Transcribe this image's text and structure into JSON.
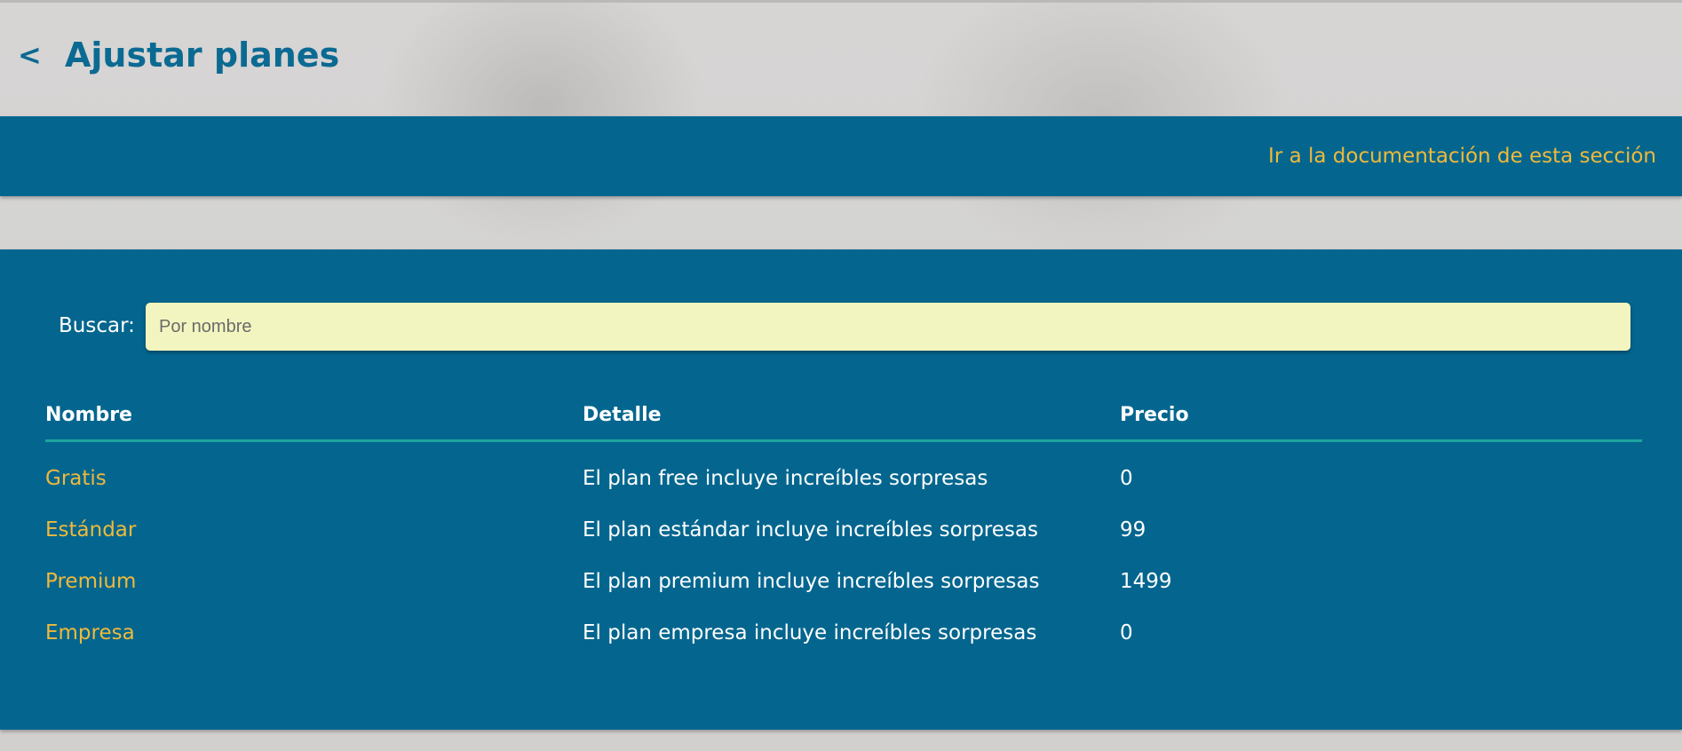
{
  "header": {
    "back_label": "<",
    "title": "Ajustar planes"
  },
  "docbar": {
    "link_label": "Ir a la documentación de esta sección"
  },
  "search": {
    "label": "Buscar:",
    "placeholder": "Por nombre",
    "value": ""
  },
  "table": {
    "columns": [
      "Nombre",
      "Detalle",
      "Precio"
    ],
    "rows": [
      {
        "name": "Gratis",
        "detail": "El plan free incluye increíbles sorpresas",
        "price": "0"
      },
      {
        "name": "Estándar",
        "detail": "El plan estándar incluye increíbles sorpresas",
        "price": "99"
      },
      {
        "name": "Premium",
        "detail": "El plan premium incluye increíbles sorpresas",
        "price": "1499"
      },
      {
        "name": "Empresa",
        "detail": "El plan empresa incluye increíbles sorpresas",
        "price": "0"
      }
    ]
  },
  "colors": {
    "primary": "#04668f",
    "accent": "#f0b93a",
    "title": "#0b6a92",
    "search_bg": "#f2f5bf",
    "divider": "#1fa4a0"
  }
}
